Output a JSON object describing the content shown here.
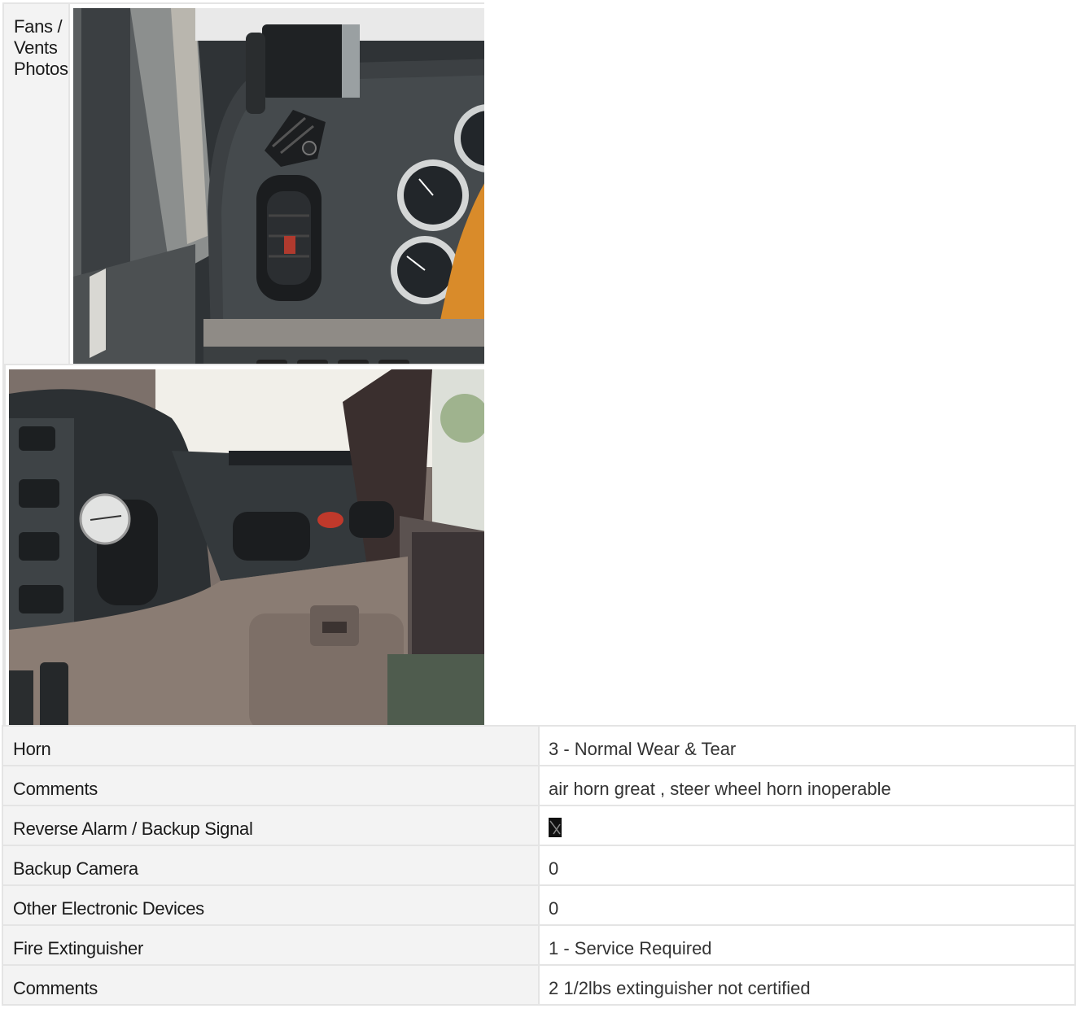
{
  "rows": {
    "fans_label": "Fans / Vents Photos",
    "horn": {
      "label": "Horn",
      "value": "3 - Normal Wear & Tear"
    },
    "horn_comments": {
      "label": "Comments",
      "value": "air horn great , steer wheel horn inoperable"
    },
    "reverse_alarm": {
      "label": "Reverse Alarm / Backup Signal"
    },
    "backup_camera": {
      "label": "Backup Camera",
      "value": "0"
    },
    "other_devices": {
      "label": "Other Electronic Devices",
      "value": "0"
    },
    "fire_extinguisher": {
      "label": "Fire Extinguisher",
      "value": "1 - Service Required"
    },
    "fire_comments": {
      "label": "Comments",
      "value": "2 1/2lbs extinguisher not certified"
    }
  },
  "icons": {
    "reverse_alarm_value": "broken-image-icon"
  }
}
